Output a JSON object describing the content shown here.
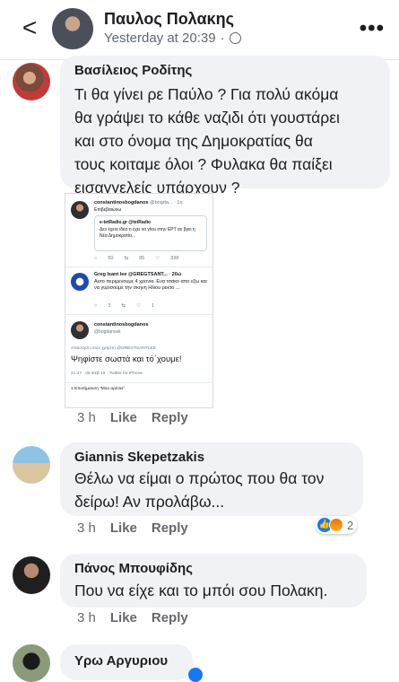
{
  "header": {
    "back_glyph": "<",
    "author_name": "Παυλος Πολακης",
    "post_time": "Yesterday at 20:39",
    "separator": "·",
    "more_glyph": "•••"
  },
  "comments": [
    {
      "name": "Βασίλειος Ροδίτης",
      "text_lines": [
        "Τι θα γίνει ρε Παύλο ? Για πολύ ακόμα",
        "θα γράψει το κάθε ναζιδι ότι γουστάρει",
        "και στο όνομα της Δημοκρατίας θα",
        "τους κοιταμε όλοι ? Φυλακα θα παίξει",
        "εισαγγελείς υπάρχουν ?"
      ],
      "time": "3 h",
      "like": "Like",
      "reply": "Reply"
    },
    {
      "name": "Giannis Skepetzakis",
      "text_lines": [
        "Θέλω να είμαι ο πρώτος που θα τον",
        "δείρω! Αν προλάβω..."
      ],
      "time": "3 h",
      "like": "Like",
      "reply": "Reply",
      "reaction_count": "2"
    },
    {
      "name": "Πάνος Μπουφίδης",
      "text_lines": [
        "Που να είχε και το μπόι σου Πολακη."
      ],
      "time": "3 h",
      "like": "Like",
      "reply": "Reply"
    },
    {
      "name": "Υρω Αργυριου"
    }
  ],
  "embed": {
    "t1_name": "constantinosbogdanos",
    "t1_handle": "@bogda... · 1η",
    "t1_reply": "Επιβεβαιώνω",
    "q_name": "e-tetRadio.gr @tetRadio",
    "q_text": "Δεν έχετε ιδέα τι έχει να γίνει στην ΕΡΤ αν βγει η Νέα Δημοκρατία...",
    "t1_actions": [
      "50",
      "95",
      "338"
    ],
    "t2_name": "Greg Isant lee @GREGTSANT... · 20ώ",
    "t2_text": "Αυτο περιμενουμε 4 χρονια. Ενα τσακο απο εξω και να γυρισουμε την σκηνη Ηλιου ρεκτο ...",
    "t2_actions": [
      "3",
      "",
      "1"
    ],
    "t3_name": "constantinosbogdanos",
    "t3_handle": "@bogdanosk",
    "t3_reply_to": "Απάντηση στον χρήστη @GREGTSANTLEE",
    "t3_text": "Ψηφίστε σωστά και τό΄χουμε!",
    "t3_meta": "21:47 · 06 Φεβ 19 · Twitter for iPhone",
    "t3_likes": "1 Επισήμανση \"Μου αρέσει\""
  },
  "colors": {
    "bubble": "#f0f2f5",
    "action_text": "#65676b",
    "like_blue": "#1877f2"
  }
}
